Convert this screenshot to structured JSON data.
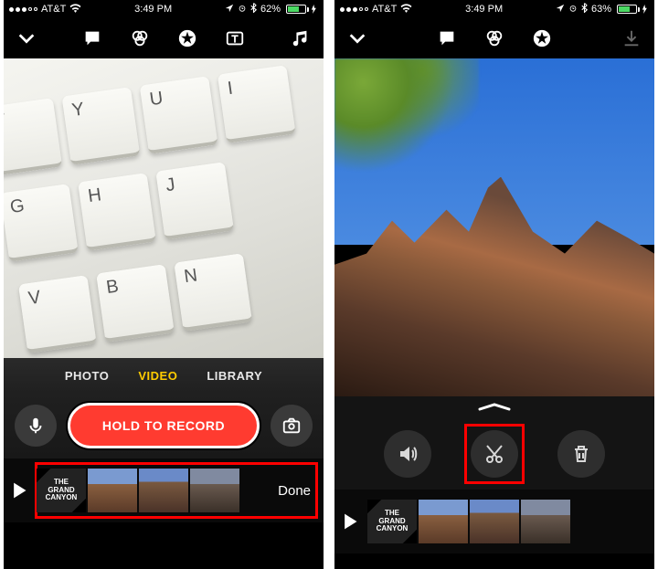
{
  "screens": {
    "left": {
      "status_bar": {
        "carrier": "AT&T",
        "time": "3:49 PM",
        "battery_pct": "62%"
      },
      "top_toolbar": {
        "collapse_name": "chevron-down-icon",
        "icons": [
          "speech-bubble-icon",
          "filters-icon",
          "star-icon",
          "text-overlay-icon",
          "music-icon"
        ]
      },
      "keyboard_rows": [
        [
          "T",
          "Y",
          "U",
          "I"
        ],
        [
          "G",
          "H",
          "J"
        ],
        [
          "V",
          "B",
          "N"
        ]
      ],
      "modes": {
        "photo": "PHOTO",
        "video": "VIDEO",
        "library": "LIBRARY",
        "active": "video"
      },
      "record_label": "HOLD TO RECORD",
      "timeline": {
        "title_card": "THE GRAND\nCANYON",
        "done_label": "Done"
      }
    },
    "right": {
      "status_bar": {
        "carrier": "AT&T",
        "time": "3:49 PM",
        "battery_pct": "63%"
      },
      "top_toolbar": {
        "collapse_name": "chevron-down-icon",
        "icons": [
          "speech-bubble-icon",
          "filters-icon",
          "star-icon"
        ],
        "download_name": "download-icon"
      },
      "tools": {
        "volume": "volume-icon",
        "trim": "scissors-icon",
        "delete": "trash-icon"
      },
      "timeline": {
        "title_card": "THE GRAND\nCANYON"
      }
    }
  }
}
